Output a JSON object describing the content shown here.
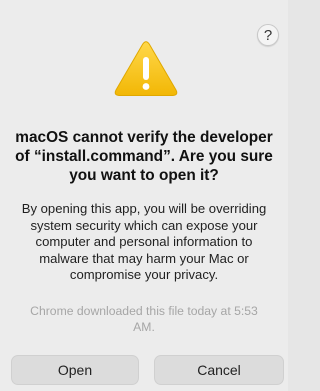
{
  "dialog": {
    "help_label": "?",
    "title": "macOS cannot verify the developer of “install.command”. Are you sure you want to open it?",
    "message": "By opening this app, you will be overriding system security which can expose your computer and personal information to malware that may harm your Mac or compromise your privacy.",
    "download_note": "Chrome downloaded this file today at 5:53 AM.",
    "warning_icon": "warning-triangle-icon"
  },
  "buttons": {
    "open_label": "Open",
    "cancel_label": "Cancel"
  },
  "colors": {
    "background": "#ececec",
    "warning_fill": "#f5c518",
    "button_bg": "#dcdcdc",
    "note_text": "#a6a6a6"
  }
}
